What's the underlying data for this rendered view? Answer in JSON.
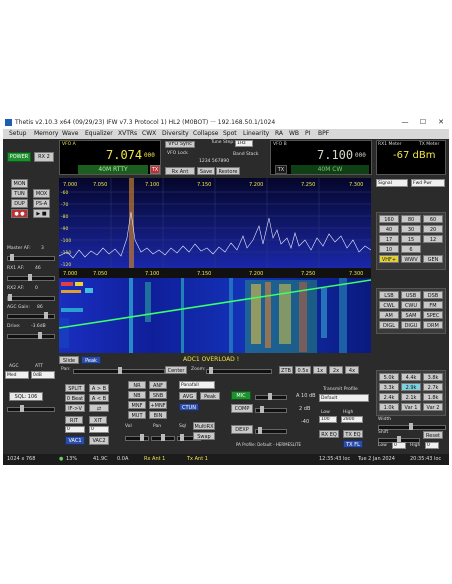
{
  "titlebar": {
    "title": "Thetis v2.10.3 x64 (09/29/23) IFW v7.3 Protocol 1) HL2 (M0BOT) ··· 192.168.50.1/1024",
    "controls": [
      "—",
      "☐",
      "✕"
    ]
  },
  "menu": [
    "Setup",
    "Memory",
    "Wave",
    "Equalizer",
    "XVTRs",
    "CWX",
    "Diversity",
    "Collapse",
    "Spot",
    "Linearity",
    "RA",
    "WB",
    "PI",
    "BPF"
  ],
  "left": {
    "power": "POWER",
    "rx2": "RX 2",
    "mon": "MON",
    "tun": "TUN",
    "mox": "MOX",
    "dup": "DUP",
    "psa": "PS-A",
    "master_af": "Master AF:",
    "master_af_val": "3",
    "rx1_af": "RX1 AF:",
    "rx1_af_val": "46",
    "rx2_af": "RX2 AF:",
    "rx2_af_val": "0",
    "agc_gain": "AGC Gain:",
    "agc_gain_val": "86",
    "drive": "Drive:",
    "drive_val": "-3.6dB",
    "agc": "AGC",
    "att": "ATT",
    "agc_mode": "Med",
    "att_val": "0dB",
    "sql": "SQL: 106"
  },
  "vfo_a": {
    "label": "VFO A",
    "freq": "7.074",
    "freq_small": "000",
    "mode": "40M RTTY",
    "tx": "TX"
  },
  "vfo_b": {
    "label": "VFO B",
    "freq": "7.100",
    "freq_small": "000",
    "mode": "40M CW",
    "tx": "TX"
  },
  "mid": {
    "vfo_sync": "VFO Sync",
    "tune_step": "Tune Step:",
    "step_val": "1Hz",
    "band_stack": "Band Stack",
    "vfo_lock": "VFO Lock",
    "stack_val": "1234 567890",
    "rx_ant": "Rx Ant",
    "save": "Save",
    "restore": "Restore"
  },
  "meter": {
    "label": "RX1 Meter",
    "tx_label": "TX Meter",
    "value": "-67 dBm",
    "signal": "Signal",
    "fwd_pwr": "Fwd Pwr"
  },
  "spectrum": {
    "freqs": [
      "7.000",
      "7.050",
      "7.100",
      "7.150",
      "7.200",
      "7.250",
      "7.300"
    ],
    "dbm": [
      "-60",
      "-70",
      "-80",
      "-90",
      "-100",
      "-110",
      "-120"
    ],
    "adc_overload": "ADC1 OVERLOAD !",
    "display": "Display",
    "pan": "Pan:",
    "center": "Center",
    "zoom": "Zoom:",
    "ztb": "ZTB",
    "zoom_btns": [
      "0.5x",
      "1x",
      "2x",
      "4x"
    ],
    "peak": "Peak",
    "slide": "Slide"
  },
  "bands": [
    "160",
    "80",
    "60",
    "40",
    "30",
    "20",
    "17",
    "15",
    "12",
    "10",
    "6",
    "VHF+",
    "WWV",
    "GEN"
  ],
  "modes": [
    "LSB",
    "USB",
    "DSB",
    "CWL",
    "CWU",
    "FM",
    "AM",
    "SAM",
    "SPEC",
    "DIGL",
    "DIGU",
    "DRM"
  ],
  "filters": [
    "5.0k",
    "4.4k",
    "3.8k",
    "3.3k",
    "2.9k",
    "2.7k",
    "2.4k",
    "2.1k",
    "1.8k",
    "1.0k",
    "Var 1",
    "Var 2"
  ],
  "bottom": {
    "split": "SPLIT",
    "ab": "A > B",
    "ba": "A < B",
    "zero_beat": "0 Beat",
    "if_v": "IF->V",
    "rit": "RIT",
    "xit": "XIT",
    "rit_val": "0",
    "xit_val": "0",
    "vac1": "VAC1",
    "vac2": "VAC2",
    "nr": "NR",
    "anf": "ANF",
    "nb": "NB",
    "snb": "SNB",
    "mnf": "MNF",
    "mute": "MUT",
    "bin": "BIN",
    "plus_mnf": "+MNF",
    "vol": "Vol",
    "pan": "Pan",
    "sql": "Sql",
    "avg": "AVG",
    "peak": "Peak",
    "ctun": "CTUN",
    "panafall": "Panafall",
    "multirx": "MultiRX",
    "swap": "Swap",
    "mic": "MIC",
    "comp": "COMP",
    "dexp": "DEXP",
    "mic_gain": "A 10 dB",
    "comp_val": "2 dB",
    "dexp_val": "-40",
    "tx_profile": "Transmit Profile",
    "profile_val": "Default",
    "low": "Low",
    "high": "High",
    "low_val": "100",
    "high_val": "2800",
    "rx_eq": "RX EQ",
    "tx_eq": "TX EQ",
    "tx_fl": "TX FL",
    "width": "Width",
    "shift": "Shift",
    "reset": "Reset",
    "pa_profile": "PA Profile: Default - HERMESLITE",
    "low2": "Low",
    "high2": "High",
    "low2_val": "0",
    "high2_val": "0"
  },
  "status": {
    "res": "1024 x 768",
    "cpu": "13%",
    "temp": "41.9C",
    "amps": "0.0A",
    "rx_ant": "Rx Ant 1",
    "tx_ant": "Tx Ant 1",
    "time_local": "12:35:43 loc",
    "date": "Tue 2 Jan 2024",
    "time_utc": "20:35:43 loc"
  },
  "colors": {
    "accent_green": "#1f8f2f",
    "vfo_yellow": "#f2e64a",
    "spectrum_bg": "#0b0e6e",
    "waterfall_green": "#39ff6a"
  }
}
